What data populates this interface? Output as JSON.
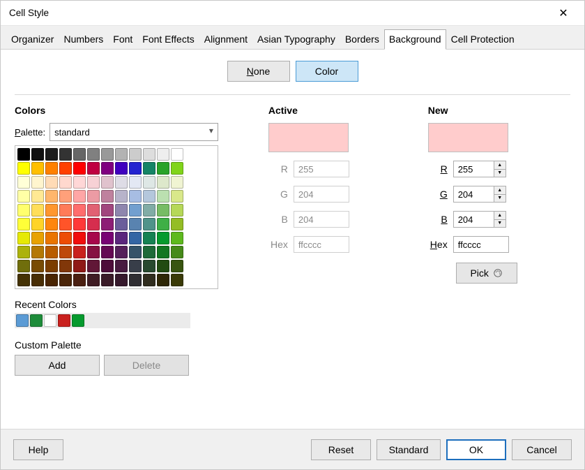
{
  "window": {
    "title": "Cell Style"
  },
  "tabs": [
    "Organizer",
    "Numbers",
    "Font",
    "Font Effects",
    "Alignment",
    "Asian Typography",
    "Borders",
    "Background",
    "Cell Protection"
  ],
  "active_tab_index": 7,
  "mode": {
    "none": "None",
    "color": "Color",
    "selected": "color"
  },
  "sections": {
    "colors": "Colors",
    "active": "Active",
    "new": "New",
    "recent": "Recent Colors",
    "custom": "Custom Palette"
  },
  "palette": {
    "label": "Palette:",
    "value": "standard"
  },
  "swatch_rows": [
    [
      "#000000",
      "#111111",
      "#1c1c1c",
      "#333333",
      "#666666",
      "#808080",
      "#999999",
      "#b3b3b3",
      "#cccccc",
      "#dddddd",
      "#eeeeee",
      "#ffffff"
    ],
    [
      "#ffff00",
      "#ffbf00",
      "#ff8000",
      "#ff4000",
      "#ff0000",
      "#bf0041",
      "#800080",
      "#4000bf",
      "#2323d0",
      "#158466",
      "#29a329",
      "#81d41a"
    ],
    [
      "#ffffd7",
      "#fff5ce",
      "#ffdbb6",
      "#ffd8ce",
      "#ffd7d7",
      "#f7d1d5",
      "#e0c2cd",
      "#dedce6",
      "#e3e8f4",
      "#dee7e5",
      "#dde8cb",
      "#f0f4d2"
    ],
    [
      "#ffffa6",
      "#ffe994",
      "#ffb66c",
      "#ffa07a",
      "#ffa6a6",
      "#ec9ba4",
      "#bf819e",
      "#b7b3ca",
      "#a7bde3",
      "#b4c7dc",
      "#bbe0b0",
      "#d9e88a"
    ],
    [
      "#ffff6d",
      "#ffde59",
      "#ff972f",
      "#ff7b59",
      "#ff6d6d",
      "#e16173",
      "#a1467e",
      "#8e86ae",
      "#729fcf",
      "#81aca6",
      "#77bc65",
      "#b6d858"
    ],
    [
      "#ffff38",
      "#ffd428",
      "#ff860d",
      "#ff5429",
      "#ff3838",
      "#d62e4e",
      "#8d1d75",
      "#6b5e9b",
      "#5983b0",
      "#50938a",
      "#3faf46",
      "#94bd25"
    ],
    [
      "#e6e905",
      "#e8a202",
      "#ea7500",
      "#ed4c05",
      "#f10d0c",
      "#a7074b",
      "#780373",
      "#5b277d",
      "#3465a4",
      "#168253",
      "#069a2e",
      "#5eb91e"
    ],
    [
      "#acb20c",
      "#b47804",
      "#b85c00",
      "#be480a",
      "#c9211e",
      "#861141",
      "#650953",
      "#55215b",
      "#355269",
      "#1e6a39",
      "#127622",
      "#468a1a"
    ],
    [
      "#706e0c",
      "#784b04",
      "#7b3d00",
      "#813709",
      "#8f1a17",
      "#611737",
      "#4e0d3a",
      "#481b40",
      "#383e49",
      "#28492f",
      "#224b12",
      "#395511"
    ],
    [
      "#443205",
      "#492e05",
      "#492401",
      "#4a2508",
      "#4b2012",
      "#3f1c24",
      "#3a1b28",
      "#36192c",
      "#2f2d32",
      "#302d1f",
      "#2e2706",
      "#3a3a07"
    ]
  ],
  "recent_colors": [
    "#5b9bd5",
    "#1e8c3a",
    "#ffffff",
    "#c9211e",
    "#069a2e"
  ],
  "custom": {
    "add": "Add",
    "delete": "Delete"
  },
  "active": {
    "color": "#ffcccc",
    "r": "255",
    "g": "204",
    "b": "204",
    "hex": "ffcccc",
    "labels": {
      "r": "R",
      "g": "G",
      "b": "B",
      "hex": "Hex"
    }
  },
  "new": {
    "color": "#ffcccc",
    "r": "255",
    "g": "204",
    "b": "204",
    "hex": "ffcccc",
    "labels": {
      "r": "R",
      "g": "G",
      "b": "B",
      "hex": "Hex"
    },
    "pick": "Pick"
  },
  "buttons": {
    "help": "Help",
    "reset": "Reset",
    "standard": "Standard",
    "ok": "OK",
    "cancel": "Cancel"
  }
}
